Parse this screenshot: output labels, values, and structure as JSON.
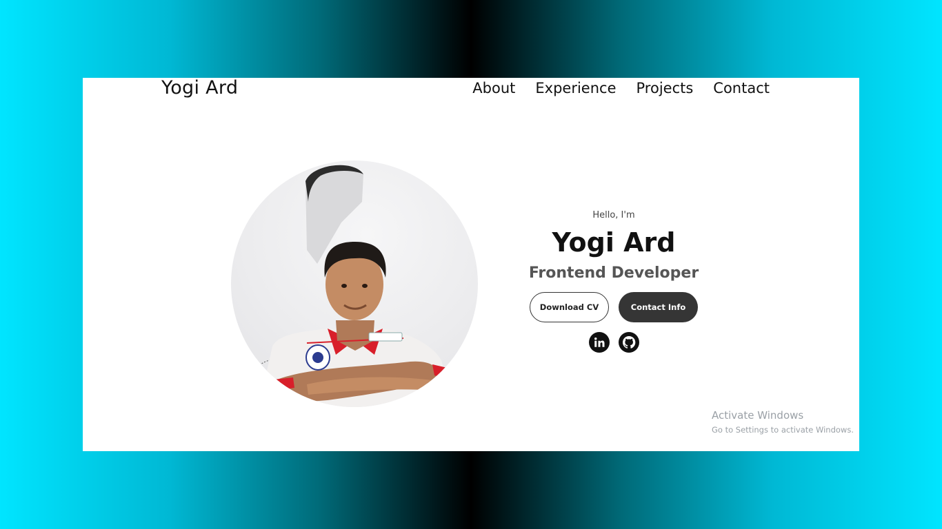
{
  "header": {
    "logo": "Yogi Ard",
    "nav": [
      "About",
      "Experience",
      "Projects",
      "Contact"
    ]
  },
  "hero": {
    "greeting": "Hello, I'm",
    "name": "Yogi Ard",
    "role": "Frontend Developer",
    "buttons": {
      "download": "Download CV",
      "contact": "Contact Info"
    },
    "socials": [
      "linkedin-icon",
      "github-icon"
    ]
  },
  "os_watermark": {
    "title": "Activate Windows",
    "subtitle": "Go to Settings to activate Windows."
  },
  "colors": {
    "background_gradient": [
      "#00e5ff",
      "#000000",
      "#00e5ff"
    ],
    "button_dark": "#353535",
    "uniform_red": "#d81f2a"
  }
}
